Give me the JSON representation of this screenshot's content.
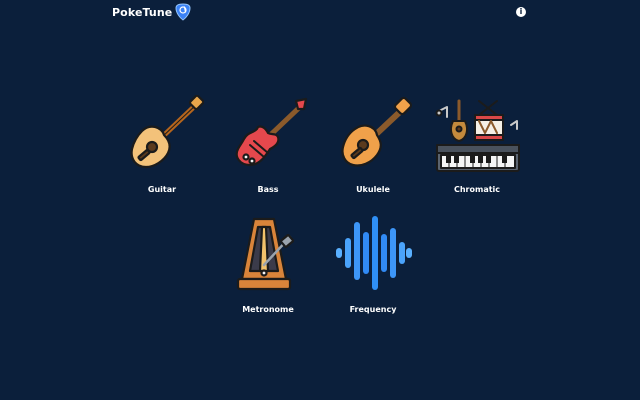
{
  "header": {
    "brand_name": "PokeTune",
    "brand_icon": "guitar-pick-icon",
    "info_icon": "info-icon",
    "info_glyph": "i"
  },
  "instruments": [
    {
      "label": "Guitar",
      "icon": "acoustic-guitar-icon"
    },
    {
      "label": "Bass",
      "icon": "electric-bass-icon"
    },
    {
      "label": "Ukulele",
      "icon": "ukulele-icon"
    },
    {
      "label": "Chromatic",
      "icon": "keyboard-drum-guitar-icon"
    }
  ],
  "tools": [
    {
      "label": "Metronome",
      "icon": "metronome-icon"
    },
    {
      "label": "Frequency",
      "icon": "sound-wave-icon"
    }
  ],
  "colors": {
    "background": "#0b1f3b",
    "text": "#ffffff",
    "pick_blue": "#3b82f6",
    "wave_blue": "#2f8ff5"
  }
}
